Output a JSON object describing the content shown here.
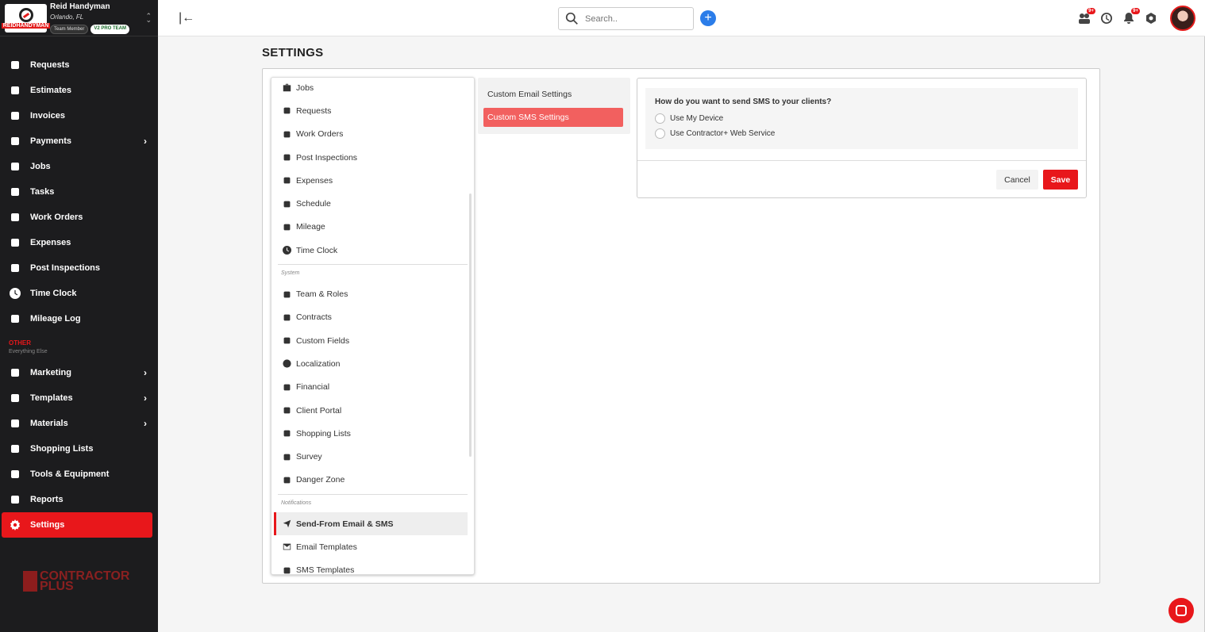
{
  "brand": {
    "name": "Reid Handyman",
    "location": "Orlando, FL",
    "logo_word": "REIDHANDYMAN",
    "tag_member": "Team Member",
    "tag_team": "V2 PRO TEAM"
  },
  "sidebar": {
    "items": [
      {
        "label": "Requests",
        "icon": "requests-icon"
      },
      {
        "label": "Estimates",
        "icon": "estimates-icon"
      },
      {
        "label": "Invoices",
        "icon": "invoices-icon"
      },
      {
        "label": "Payments",
        "icon": "payments-icon",
        "chevron": true
      },
      {
        "label": "Jobs",
        "icon": "jobs-icon"
      },
      {
        "label": "Tasks",
        "icon": "tasks-icon"
      },
      {
        "label": "Work Orders",
        "icon": "work-orders-icon"
      },
      {
        "label": "Expenses",
        "icon": "expenses-icon"
      },
      {
        "label": "Post Inspections",
        "icon": "post-inspections-icon"
      },
      {
        "label": "Time Clock",
        "icon": "clock-icon"
      },
      {
        "label": "Mileage Log",
        "icon": "mileage-icon"
      }
    ],
    "other_title": "OTHER",
    "other_subtitle": "Everything Else",
    "other_items": [
      {
        "label": "Marketing",
        "icon": "marketing-icon",
        "chevron": true
      },
      {
        "label": "Templates",
        "icon": "templates-icon",
        "chevron": true
      },
      {
        "label": "Materials",
        "icon": "materials-icon",
        "chevron": true
      },
      {
        "label": "Shopping Lists",
        "icon": "shopping-lists-icon"
      },
      {
        "label": "Tools & Equipment",
        "icon": "tools-icon"
      },
      {
        "label": "Reports",
        "icon": "reports-icon"
      },
      {
        "label": "Settings",
        "icon": "gear-icon",
        "active": true
      }
    ],
    "footer_logo_line1": "CONTRACTOR",
    "footer_logo_line2": "PLUS"
  },
  "topbar": {
    "search_placeholder": "Search..",
    "badge_1": "9+",
    "badge_2": "9+"
  },
  "page": {
    "title": "SETTINGS"
  },
  "settings_menu": {
    "items_top": [
      {
        "label": "Jobs",
        "icon": "briefcase-icon"
      },
      {
        "label": "Requests",
        "icon": "requests-icon"
      },
      {
        "label": "Work Orders",
        "icon": "work-orders-icon"
      },
      {
        "label": "Post Inspections",
        "icon": "post-inspections-icon"
      },
      {
        "label": "Expenses",
        "icon": "expenses-icon"
      },
      {
        "label": "Schedule",
        "icon": "calendar-icon"
      },
      {
        "label": "Mileage",
        "icon": "mileage-icon"
      },
      {
        "label": "Time Clock",
        "icon": "clock-icon"
      }
    ],
    "group_system": "System",
    "items_system": [
      {
        "label": "Team & Roles",
        "icon": "team-icon"
      },
      {
        "label": "Contracts",
        "icon": "contracts-icon"
      },
      {
        "label": "Custom Fields",
        "icon": "custom-fields-icon"
      },
      {
        "label": "Localization",
        "icon": "globe-icon"
      },
      {
        "label": "Financial",
        "icon": "financial-icon"
      },
      {
        "label": "Client Portal",
        "icon": "client-portal-icon"
      },
      {
        "label": "Shopping Lists",
        "icon": "shopping-lists-icon"
      },
      {
        "label": "Survey",
        "icon": "survey-icon"
      },
      {
        "label": "Danger Zone",
        "icon": "danger-icon"
      }
    ],
    "group_notifications": "Notifications",
    "items_notifications": [
      {
        "label": "Send-From Email & SMS",
        "icon": "send-icon",
        "active": true
      },
      {
        "label": "Email Templates",
        "icon": "mail-icon"
      },
      {
        "label": "SMS Templates",
        "icon": "sms-icon"
      }
    ]
  },
  "submenu": {
    "email": "Custom Email Settings",
    "sms": "Custom SMS Settings"
  },
  "sms_panel": {
    "question": "How do you want to send SMS to your clients?",
    "option_device": "Use My Device",
    "option_service": "Use Contractor+ Web Service",
    "cancel": "Cancel",
    "save": "Save"
  },
  "colors": {
    "accent": "#e8171b",
    "sidebar_bg": "#1c1c1e",
    "submenu_active": "#f2605f",
    "add_button": "#2b7de9"
  }
}
